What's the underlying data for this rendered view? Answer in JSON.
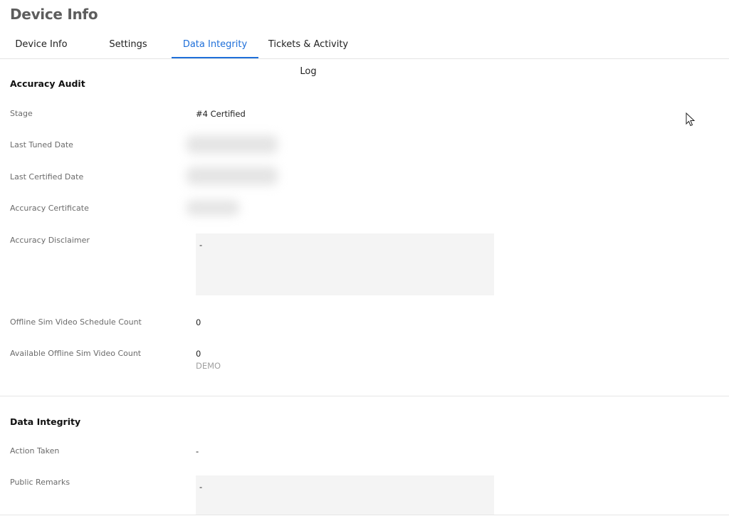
{
  "page": {
    "title": "Device Info"
  },
  "tabs": [
    {
      "label": "Device Info"
    },
    {
      "label": "Settings"
    },
    {
      "label": "Data Integrity"
    },
    {
      "label": "Tickets & Activity Log"
    }
  ],
  "accuracy_audit": {
    "title": "Accuracy Audit",
    "stage": {
      "label": "Stage",
      "value": "#4 Certified"
    },
    "last_tuned_date": {
      "label": "Last Tuned Date"
    },
    "last_certified_date": {
      "label": "Last Certified Date"
    },
    "accuracy_certificate": {
      "label": "Accuracy Certificate"
    },
    "accuracy_disclaimer": {
      "label": "Accuracy Disclaimer",
      "value": "-"
    },
    "offline_sim_video_schedule_count": {
      "label": "Offline Sim Video Schedule Count",
      "value": "0"
    },
    "available_offline_sim_video_count": {
      "label": "Available Offline Sim Video Count",
      "value": "0",
      "note": "DEMO"
    }
  },
  "data_integrity": {
    "title": "Data Integrity",
    "action_taken": {
      "label": "Action Taken",
      "value": "-"
    },
    "public_remarks": {
      "label": "Public Remarks",
      "value": "-"
    }
  },
  "colors": {
    "accent": "#1e6fd9",
    "field_bg": "#f4f4f4"
  },
  "icons": {
    "cursor": "mouse-pointer-icon"
  }
}
